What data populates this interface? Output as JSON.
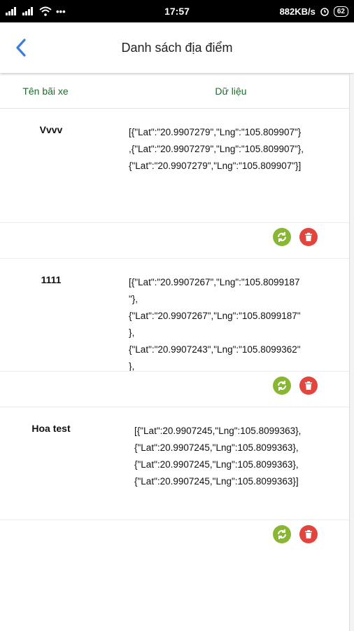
{
  "status": {
    "time": "17:57",
    "network_speed": "882KB/s",
    "battery": "62"
  },
  "app_bar": {
    "title": "Danh sách địa điểm"
  },
  "table": {
    "headers": {
      "name": "Tên bãi xe",
      "data": "Dữ liệu"
    },
    "items": [
      {
        "name": "Vvvv",
        "data": "[{\"Lat\":\"20.9907279\",\"Lng\":\"105.809907\"}\n,{\"Lat\":\"20.9907279\",\"Lng\":\"105.809907\"},\n{\"Lat\":\"20.9907279\",\"Lng\":\"105.809907\"}]"
      },
      {
        "name": "1111",
        "data": "[{\"Lat\":\"20.9907267\",\"Lng\":\"105.8099187\n\"},\n{\"Lat\":\"20.9907267\",\"Lng\":\"105.8099187\"\n},\n{\"Lat\":\"20.9907243\",\"Lng\":\"105.8099362\"\n},"
      },
      {
        "name": "Hoa test",
        "data": "[{\"Lat\":20.9907245,\"Lng\":105.8099363},\n{\"Lat\":20.9907245,\"Lng\":105.8099363},\n{\"Lat\":20.9907245,\"Lng\":105.8099363},\n{\"Lat\":20.9907245,\"Lng\":105.8099363}]"
      }
    ]
  },
  "icons": {
    "sync": "sync-icon",
    "delete": "trash-icon",
    "back": "chevron-left-icon"
  },
  "colors": {
    "header_text": "#1f6b2b",
    "back_arrow": "#3b7ddd",
    "sync": "#8ab733",
    "delete": "#e2453c"
  }
}
